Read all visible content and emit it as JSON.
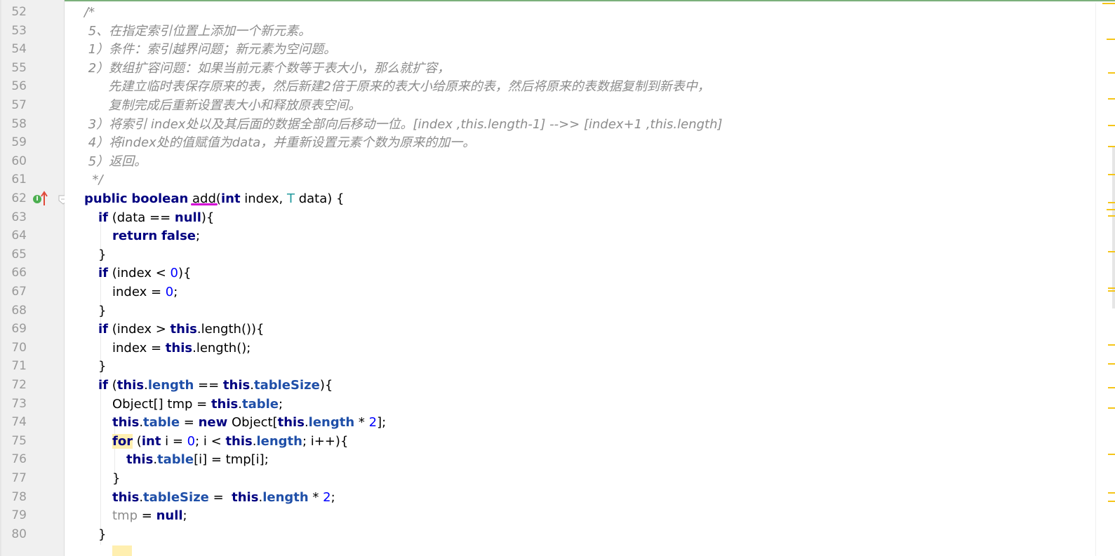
{
  "editor": {
    "lines": [
      {
        "n": "52",
        "indent": 0,
        "tokens": [
          {
            "t": "comment",
            "v": "/*"
          }
        ]
      },
      {
        "n": "53",
        "indent": 0,
        "tokens": [
          {
            "t": "comment",
            "v": " 5、在指定索引位置上添加一个新元素。"
          }
        ]
      },
      {
        "n": "54",
        "indent": 0,
        "tokens": [
          {
            "t": "comment",
            "v": " 1）条件：索引越界问题；新元素为空问题。"
          }
        ]
      },
      {
        "n": "55",
        "indent": 0,
        "tokens": [
          {
            "t": "comment",
            "v": " 2）数组扩容问题：如果当前元素个数等于表大小，那么就扩容，"
          }
        ]
      },
      {
        "n": "56",
        "indent": 0,
        "tokens": [
          {
            "t": "comment",
            "v": "      先建立临时表保存原来的表，然后新建2倍于原来的表大小给原来的表，然后将原来的表数据复制到新表中，"
          }
        ]
      },
      {
        "n": "57",
        "indent": 0,
        "tokens": [
          {
            "t": "comment",
            "v": "      复制完成后重新设置表大小和释放原表空间。"
          }
        ]
      },
      {
        "n": "58",
        "indent": 0,
        "tokens": [
          {
            "t": "comment",
            "v": " 3）将索引 index处以及其后面的数据全部向后移动一位。[index ,this.length-1] -->> [index+1 ,this.length]"
          }
        ]
      },
      {
        "n": "59",
        "indent": 0,
        "tokens": [
          {
            "t": "comment",
            "v": " 4）将index处的值赋值为data，并重新设置元素个数为原来的加一。"
          }
        ]
      },
      {
        "n": "60",
        "indent": 0,
        "tokens": [
          {
            "t": "comment",
            "v": " 5）返回。"
          }
        ]
      },
      {
        "n": "61",
        "indent": 0,
        "tokens": [
          {
            "t": "comment",
            "v": "  */"
          }
        ]
      },
      {
        "n": "62",
        "indent": 0,
        "tokens": [
          {
            "t": "keyword",
            "v": "public"
          },
          {
            "t": "plain",
            "v": " "
          },
          {
            "t": "keyword",
            "v": "boolean"
          },
          {
            "t": "plain",
            "v": " "
          },
          {
            "t": "method",
            "v": "add"
          },
          {
            "t": "plain",
            "v": "("
          },
          {
            "t": "keyword",
            "v": "int"
          },
          {
            "t": "plain",
            "v": " index, "
          },
          {
            "t": "type",
            "v": "T"
          },
          {
            "t": "plain",
            "v": " data) {"
          }
        ]
      },
      {
        "n": "63",
        "indent": 1,
        "tokens": [
          {
            "t": "keyword",
            "v": "if"
          },
          {
            "t": "plain",
            "v": " (data == "
          },
          {
            "t": "keyword",
            "v": "null"
          },
          {
            "t": "plain",
            "v": "){"
          }
        ]
      },
      {
        "n": "64",
        "indent": 2,
        "tokens": [
          {
            "t": "keyword",
            "v": "return"
          },
          {
            "t": "plain",
            "v": " "
          },
          {
            "t": "keyword",
            "v": "false"
          },
          {
            "t": "plain",
            "v": ";"
          }
        ]
      },
      {
        "n": "65",
        "indent": 1,
        "tokens": [
          {
            "t": "plain",
            "v": "}"
          }
        ]
      },
      {
        "n": "66",
        "indent": 1,
        "tokens": [
          {
            "t": "keyword",
            "v": "if"
          },
          {
            "t": "plain",
            "v": " (index < "
          },
          {
            "t": "number",
            "v": "0"
          },
          {
            "t": "plain",
            "v": "){"
          }
        ]
      },
      {
        "n": "67",
        "indent": 2,
        "tokens": [
          {
            "t": "plain",
            "v": "index = "
          },
          {
            "t": "number",
            "v": "0"
          },
          {
            "t": "plain",
            "v": ";"
          }
        ]
      },
      {
        "n": "68",
        "indent": 1,
        "tokens": [
          {
            "t": "plain",
            "v": "}"
          }
        ]
      },
      {
        "n": "69",
        "indent": 1,
        "tokens": [
          {
            "t": "keyword",
            "v": "if"
          },
          {
            "t": "plain",
            "v": " (index > "
          },
          {
            "t": "keyword",
            "v": "this"
          },
          {
            "t": "plain",
            "v": ".length()){"
          }
        ]
      },
      {
        "n": "70",
        "indent": 2,
        "tokens": [
          {
            "t": "plain",
            "v": "index = "
          },
          {
            "t": "keyword",
            "v": "this"
          },
          {
            "t": "plain",
            "v": ".length();"
          }
        ]
      },
      {
        "n": "71",
        "indent": 1,
        "tokens": [
          {
            "t": "plain",
            "v": "}"
          }
        ]
      },
      {
        "n": "72",
        "indent": 1,
        "tokens": [
          {
            "t": "keyword",
            "v": "if"
          },
          {
            "t": "plain",
            "v": " ("
          },
          {
            "t": "keyword",
            "v": "this"
          },
          {
            "t": "plain",
            "v": "."
          },
          {
            "t": "field",
            "v": "length"
          },
          {
            "t": "plain",
            "v": " == "
          },
          {
            "t": "keyword",
            "v": "this"
          },
          {
            "t": "plain",
            "v": "."
          },
          {
            "t": "field",
            "v": "tableSize"
          },
          {
            "t": "plain",
            "v": "){"
          }
        ]
      },
      {
        "n": "73",
        "indent": 2,
        "tokens": [
          {
            "t": "plain",
            "v": "Object[] tmp = "
          },
          {
            "t": "keyword",
            "v": "this"
          },
          {
            "t": "plain",
            "v": "."
          },
          {
            "t": "field",
            "v": "table"
          },
          {
            "t": "plain",
            "v": ";"
          }
        ]
      },
      {
        "n": "74",
        "indent": 2,
        "tokens": [
          {
            "t": "keyword",
            "v": "this"
          },
          {
            "t": "plain",
            "v": "."
          },
          {
            "t": "field",
            "v": "table"
          },
          {
            "t": "plain",
            "v": " = "
          },
          {
            "t": "keyword",
            "v": "new"
          },
          {
            "t": "plain",
            "v": " Object["
          },
          {
            "t": "keyword",
            "v": "this"
          },
          {
            "t": "plain",
            "v": "."
          },
          {
            "t": "field",
            "v": "length"
          },
          {
            "t": "plain",
            "v": " * "
          },
          {
            "t": "number",
            "v": "2"
          },
          {
            "t": "plain",
            "v": "];"
          }
        ]
      },
      {
        "n": "75",
        "indent": 2,
        "tokens": [
          {
            "t": "keyword-hl",
            "v": "for"
          },
          {
            "t": "plain",
            "v": " ("
          },
          {
            "t": "keyword",
            "v": "int"
          },
          {
            "t": "plain",
            "v": " i = "
          },
          {
            "t": "number",
            "v": "0"
          },
          {
            "t": "plain",
            "v": "; i < "
          },
          {
            "t": "keyword",
            "v": "this"
          },
          {
            "t": "plain",
            "v": "."
          },
          {
            "t": "field",
            "v": "length"
          },
          {
            "t": "plain",
            "v": "; i++){"
          }
        ]
      },
      {
        "n": "76",
        "indent": 3,
        "tokens": [
          {
            "t": "keyword",
            "v": "this"
          },
          {
            "t": "plain",
            "v": "."
          },
          {
            "t": "field",
            "v": "table"
          },
          {
            "t": "plain",
            "v": "[i] = tmp[i];"
          }
        ]
      },
      {
        "n": "77",
        "indent": 2,
        "tokens": [
          {
            "t": "plain",
            "v": "}"
          }
        ]
      },
      {
        "n": "78",
        "indent": 2,
        "tokens": [
          {
            "t": "keyword",
            "v": "this"
          },
          {
            "t": "plain",
            "v": "."
          },
          {
            "t": "field",
            "v": "tableSize"
          },
          {
            "t": "plain",
            "v": " =  "
          },
          {
            "t": "keyword",
            "v": "this"
          },
          {
            "t": "plain",
            "v": "."
          },
          {
            "t": "field",
            "v": "length"
          },
          {
            "t": "plain",
            "v": " * "
          },
          {
            "t": "number",
            "v": "2"
          },
          {
            "t": "plain",
            "v": ";"
          }
        ]
      },
      {
        "n": "79",
        "indent": 2,
        "tokens": [
          {
            "t": "unused",
            "v": "tmp"
          },
          {
            "t": "plain",
            "v": " = "
          },
          {
            "t": "keyword",
            "v": "null"
          },
          {
            "t": "plain",
            "v": ";"
          }
        ]
      },
      {
        "n": "80",
        "indent": 1,
        "tokens": [
          {
            "t": "plain",
            "v": "}"
          }
        ]
      }
    ]
  },
  "gutter": {
    "implementation_icon_label": "I",
    "implementation_icon": "implements-method-icon",
    "override_icon": "override-arrow-icon",
    "fold_icon": "fold-marker-icon"
  },
  "colors": {
    "comment": "#8c8c8c",
    "keyword": "#000080",
    "field": "#1f4fa8",
    "number": "#0000ff",
    "warning_mark": "#f5c518"
  }
}
